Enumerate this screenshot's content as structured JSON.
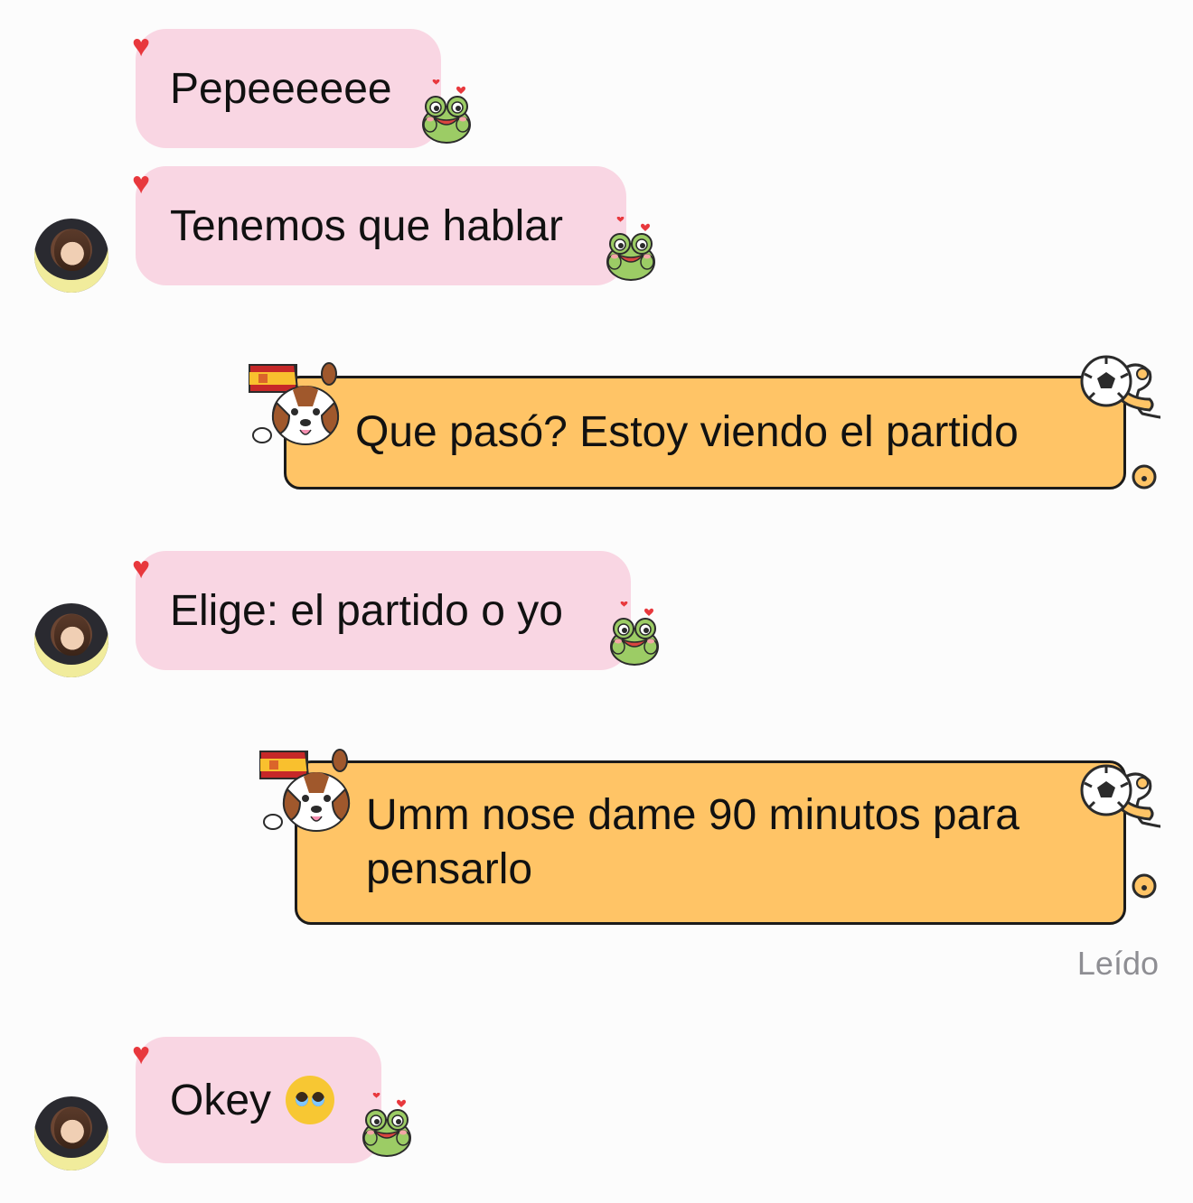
{
  "colors": {
    "incoming_bubble": "#f9d6e3",
    "outgoing_bubble": "#ffc466",
    "outgoing_border": "#1b1b1b",
    "reaction_heart": "#e8383d",
    "read_receipt": "#8e8e93"
  },
  "messages": [
    {
      "direction": "incoming",
      "text": "Pepeeeeee",
      "reaction": "heart-icon",
      "sticker": "frog-sticker"
    },
    {
      "direction": "incoming",
      "text": "Tenemos que hablar",
      "reaction": "heart-icon",
      "sticker": "frog-sticker"
    },
    {
      "direction": "outgoing",
      "text": "Que pasó? Estoy viendo el partido",
      "decoration": [
        "spain-flag-dog-sticker",
        "soccer-ball-icon"
      ]
    },
    {
      "direction": "incoming",
      "text": "Elige: el partido o yo",
      "reaction": "heart-icon",
      "sticker": "frog-sticker"
    },
    {
      "direction": "outgoing",
      "text_line1": "Umm nose dame 90 minutos para",
      "text_line2": "pensarlo",
      "decoration": [
        "spain-flag-dog-sticker",
        "soccer-ball-icon"
      ]
    },
    {
      "direction": "incoming",
      "text": "Okey",
      "emoji": "pleading-face-emoji",
      "reaction": "heart-icon",
      "sticker": "frog-sticker"
    }
  ],
  "read_receipt": "Leído"
}
